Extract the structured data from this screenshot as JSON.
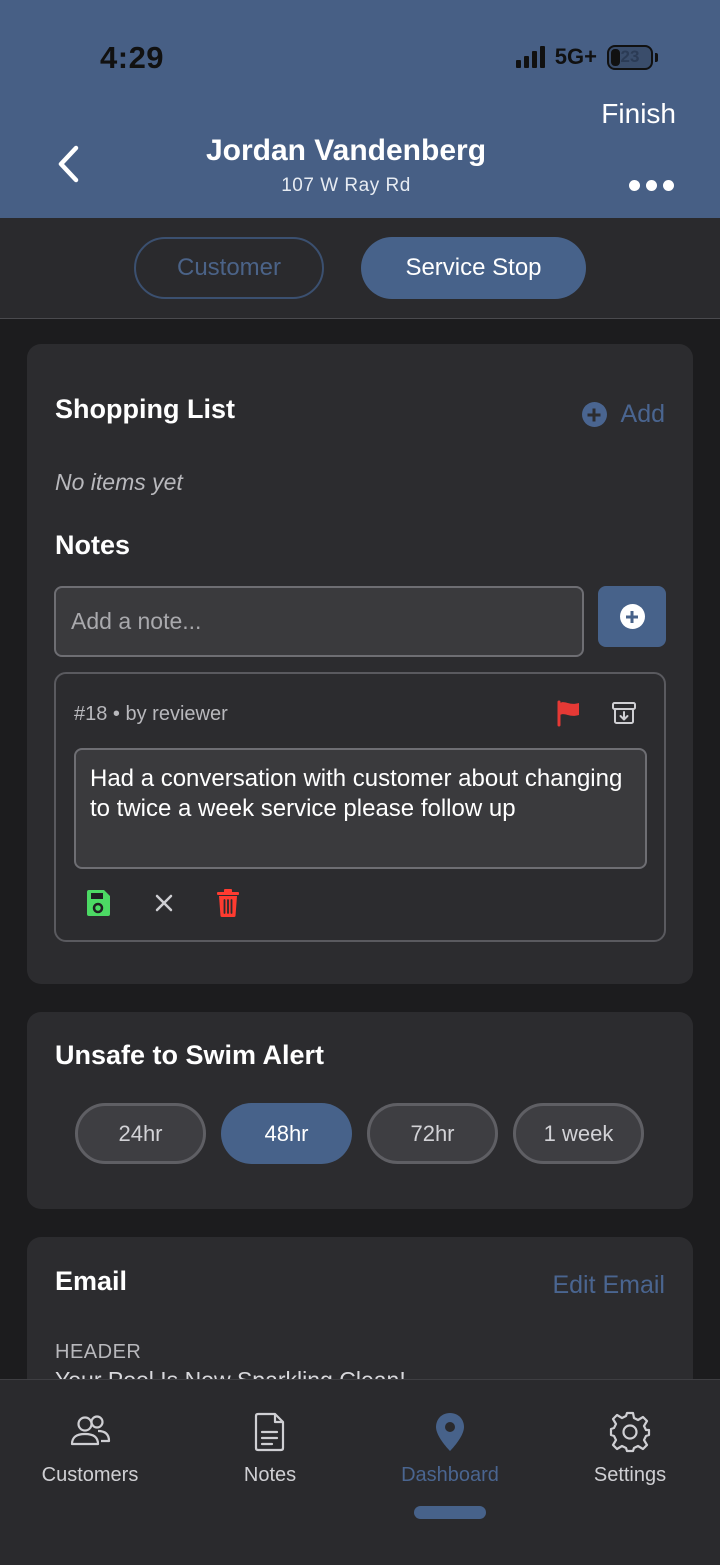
{
  "status": {
    "time": "4:29",
    "network": "5G+",
    "battery": "23"
  },
  "header": {
    "finish_label": "Finish",
    "title": "Jordan Vandenberg",
    "subtitle": "107 W Ray Rd"
  },
  "segments": {
    "customer": "Customer",
    "service_stop": "Service Stop",
    "selected": "Service Stop"
  },
  "shopping_list": {
    "title": "Shopping List",
    "add_label": "Add",
    "empty_text": "No items yet"
  },
  "notes": {
    "title": "Notes",
    "input_placeholder": "Add a note...",
    "items": [
      {
        "meta": "#18 • by reviewer",
        "text": "Had a conversation with customer about changing to twice a week service please follow up"
      }
    ]
  },
  "unsafe_alert": {
    "title": "Unsafe to Swim Alert",
    "options": [
      "24hr",
      "48hr",
      "72hr",
      "1 week"
    ],
    "selected": "48hr"
  },
  "email": {
    "title": "Email",
    "edit_label": "Edit Email",
    "header_label": "HEADER",
    "header_value": "Your Pool Is Now Sparkling Clean!"
  },
  "tabbar": {
    "items": [
      {
        "label": "Customers",
        "icon": "users-icon"
      },
      {
        "label": "Notes",
        "icon": "document-icon"
      },
      {
        "label": "Dashboard",
        "icon": "map-pin-icon"
      },
      {
        "label": "Settings",
        "icon": "gear-icon"
      }
    ],
    "active": "Dashboard"
  },
  "colors": {
    "header_bg": "#475f85",
    "accent": "#47628a",
    "flag": "#e53935",
    "save": "#4cd964",
    "delete": "#ff3b30"
  }
}
